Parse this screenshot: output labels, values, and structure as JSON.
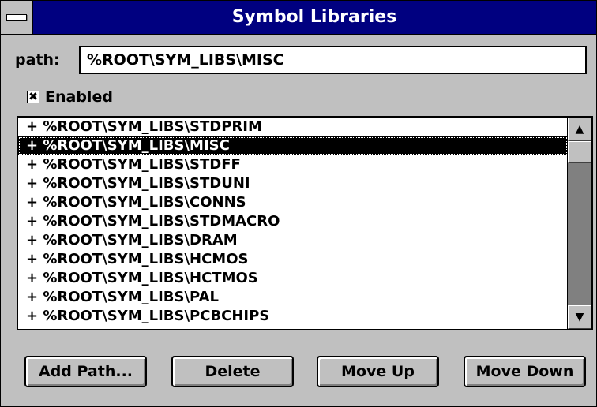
{
  "window": {
    "title": "Symbol Libraries",
    "sysmenu_icon": "system-menu-icon"
  },
  "path_field": {
    "label": "path:",
    "value": "%ROOT\\SYM_LIBS\\MISC"
  },
  "enabled": {
    "checked": true,
    "check_glyph": "✖",
    "label": "Enabled"
  },
  "library_list": {
    "items": [
      "+ %ROOT\\SYM_LIBS\\STDPRIM",
      "+ %ROOT\\SYM_LIBS\\MISC",
      "+ %ROOT\\SYM_LIBS\\STDFF",
      "+ %ROOT\\SYM_LIBS\\STDUNI",
      "+ %ROOT\\SYM_LIBS\\CONNS",
      "+ %ROOT\\SYM_LIBS\\STDMACRO",
      "+ %ROOT\\SYM_LIBS\\DRAM",
      "+ %ROOT\\SYM_LIBS\\HCMOS",
      "+ %ROOT\\SYM_LIBS\\HCTMOS",
      "+ %ROOT\\SYM_LIBS\\PAL",
      "+ %ROOT\\SYM_LIBS\\PCBCHIPS"
    ],
    "selected_index": 1,
    "scroll_up_glyph": "▲",
    "scroll_down_glyph": "▼"
  },
  "buttons": {
    "add_path": "Add Path...",
    "delete": "Delete",
    "move_up": "Move Up",
    "move_down": "Move Down"
  }
}
